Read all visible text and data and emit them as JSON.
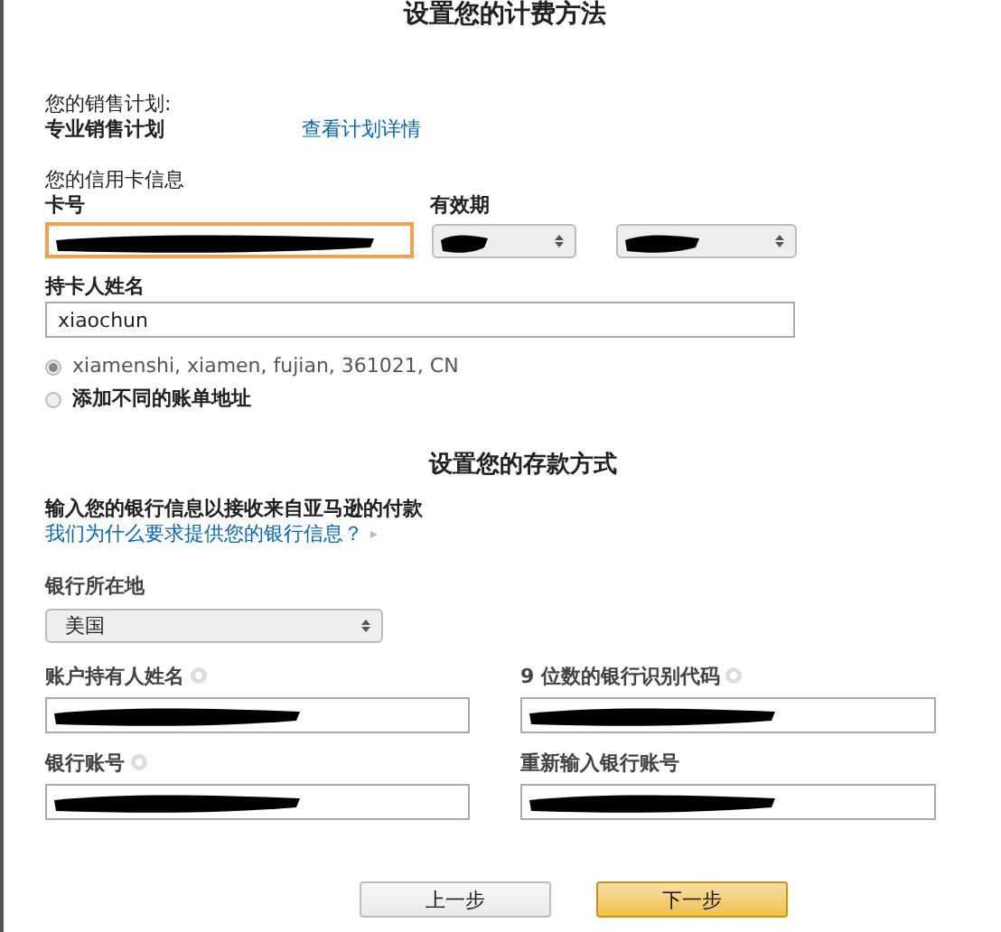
{
  "billing": {
    "title": "设置您的计费方法",
    "plan_label": "您的销售计划:",
    "plan_name": "专业销售计划",
    "plan_link": "查看计划详情",
    "card_heading": "您的信用卡信息",
    "card_number": {
      "label": "卡号",
      "redacted": true,
      "focused": true
    },
    "expiry": {
      "label": "有效期",
      "selects": [
        {
          "redacted": true
        },
        {
          "redacted": true
        }
      ]
    },
    "holder": {
      "label": "持卡人姓名",
      "value": "xiaochun"
    },
    "addresses": [
      {
        "label": "xiamenshi, xiamen, fujian, 361021, CN",
        "selected": true,
        "bold": false
      },
      {
        "label": "添加不同的账单地址",
        "selected": false,
        "bold": true
      }
    ]
  },
  "deposit": {
    "title": "设置您的存款方式",
    "intro": "输入您的银行信息以接收来自亚马逊的付款",
    "why_link": "我们为什么要求提供您的银行信息？",
    "country": {
      "label": "银行所在地",
      "value": "美国"
    },
    "fields": [
      {
        "label": "账户持有人姓名",
        "help": true,
        "redacted": true
      },
      {
        "label": "9 位数的银行识别代码",
        "help": true,
        "redacted": true
      },
      {
        "label": "银行账号",
        "help": true,
        "redacted": true
      },
      {
        "label": "重新输入银行账号",
        "help": false,
        "redacted": true
      }
    ]
  },
  "buttons": [
    {
      "label": "上一步",
      "kind": "secondary"
    },
    {
      "label": "下一步",
      "kind": "primary"
    }
  ]
}
